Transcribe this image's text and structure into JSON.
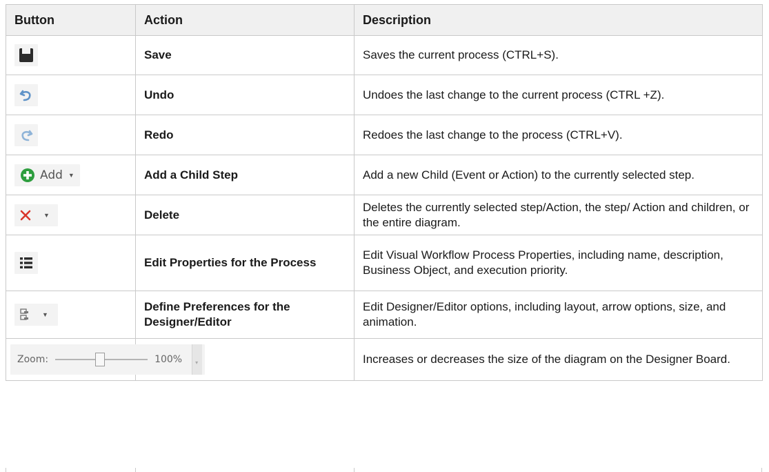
{
  "table": {
    "headers": {
      "button": "Button",
      "action": "Action",
      "description": "Description"
    },
    "rows": [
      {
        "action": "Save",
        "description": "Saves the current process (CTRL+S).",
        "icon": "save-icon"
      },
      {
        "action": "Undo",
        "description": "Undoes the last change to the current process (CTRL +Z).",
        "icon": "undo-icon"
      },
      {
        "action": "Redo",
        "description": "Redoes the last change to the process (CTRL+V).",
        "icon": "redo-icon"
      },
      {
        "action": "Add a Child Step",
        "description": "Add a new Child (Event or Action) to the currently selected step.",
        "icon": "add-plus-icon",
        "button_label": "Add"
      },
      {
        "action": "Delete",
        "description": "Deletes the currently selected step/Action, the step/ Action and children, or the entire diagram.",
        "icon": "delete-x-icon"
      },
      {
        "action": "Edit Properties for the Process",
        "description": "Edit Visual Workflow Process Properties, including name, description, Business Object, and execution priority.",
        "icon": "properties-list-icon"
      },
      {
        "action": "Define Preferences for the Designer/Editor",
        "description": "Edit Designer/Editor options, including layout, arrow options, size, and animation.",
        "icon": "preferences-icon"
      },
      {
        "action": "",
        "description": "Increases or decreases the size of the diagram on the Designer Board.",
        "icon": "zoom-slider",
        "zoom_label": "Zoom:",
        "zoom_value": "100%"
      }
    ]
  },
  "colors": {
    "header_bg": "#f0f0f0",
    "border": "#c9c9c9",
    "add_green": "#2e9e3f",
    "delete_red": "#d9352b",
    "undo_blue": "#5f93c8"
  }
}
